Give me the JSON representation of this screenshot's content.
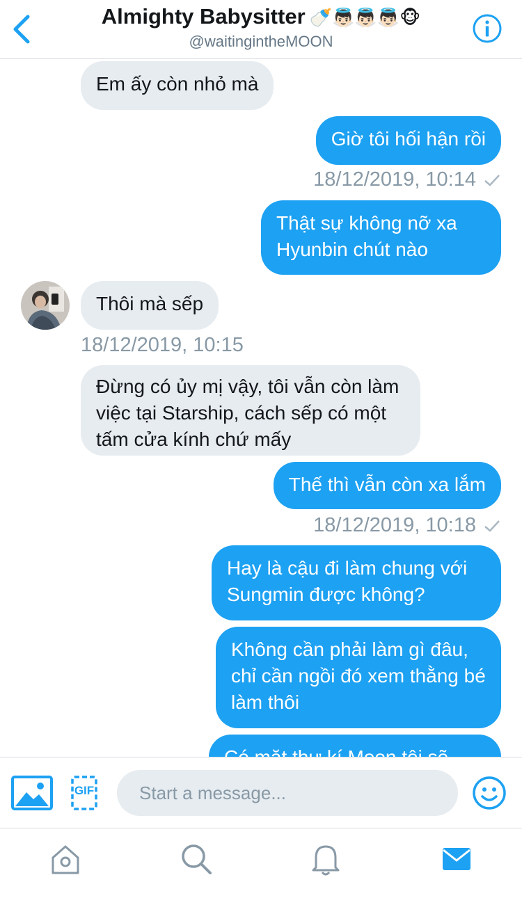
{
  "header": {
    "title": "Almighty Babysitter",
    "emojis": "🍼👼🏻👼🏻👼🏻🐵",
    "handle": "@waitingintheMOON",
    "back_icon": "chevron-left-icon",
    "info_icon": "info-icon"
  },
  "messages": [
    {
      "side": "in",
      "text": "Em ấy còn nhỏ mà"
    },
    {
      "side": "out",
      "text": "Giờ tôi hối hận rồi"
    },
    {
      "time": "18/12/2019, 10:14"
    },
    {
      "side": "out",
      "text": "Thật sự không nỡ xa Hyunbin chút nào"
    },
    {
      "side": "in",
      "text": "Thôi mà sếp"
    },
    {
      "time": "18/12/2019, 10:15"
    },
    {
      "side": "in",
      "text": "Đừng có ủy mị vậy, tôi vẫn còn làm việc tại Starship, cách sếp có một tấm cửa kính chứ mấy"
    },
    {
      "side": "out",
      "text": "Thế thì vẫn còn xa lắm"
    },
    {
      "time": "18/12/2019, 10:18"
    },
    {
      "side": "out",
      "text": "Hay là cậu đi làm chung với Sungmin được không?"
    },
    {
      "side": "out",
      "text": "Không cần phải làm gì đâu, chỉ cần ngồi đó xem thằng bé làm thôi"
    },
    {
      "side": "out",
      "text": "Có mặt thư kí Moon tôi sẽ"
    }
  ],
  "composer": {
    "placeholder": "Start a message...",
    "gif_label": "GIF",
    "image_icon": "image-icon",
    "emoji_icon": "emoji-icon"
  },
  "tabbar": {
    "items": [
      "home-icon",
      "search-icon",
      "notifications-icon",
      "messages-icon"
    ],
    "active": "messages-icon"
  },
  "colors": {
    "accent": "#1da1f2",
    "incoming_bubble": "#e6ecf0",
    "timestamp": "#8899a6"
  }
}
